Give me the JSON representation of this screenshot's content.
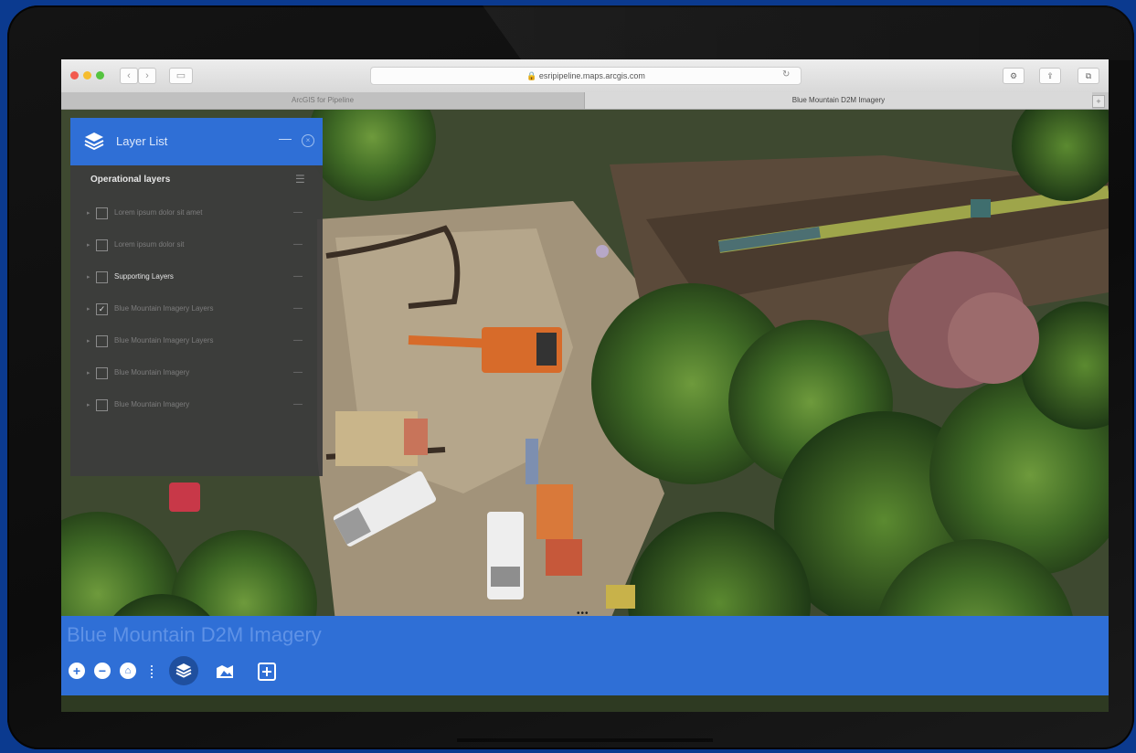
{
  "browser": {
    "url": "esripipeline.maps.arcgis.com",
    "tabs": [
      "ArcGIS for Pipeline",
      "Blue Mountain D2M Imagery"
    ],
    "back_icon": "chevron-left-icon",
    "forward_icon": "chevron-right-icon"
  },
  "layer_list": {
    "title": "Layer List",
    "section_title": "Operational layers",
    "layers": [
      {
        "label": "Lorem ipsum dolor sit amet",
        "checked": false,
        "bright": false
      },
      {
        "label": "Lorem ipsum dolor sit",
        "checked": false,
        "bright": false
      },
      {
        "label": "Supporting Layers",
        "checked": false,
        "bright": true
      },
      {
        "label": "Blue Mountain Imagery Layers",
        "checked": true,
        "bright": false
      },
      {
        "label": "Blue Mountain Imagery Layers",
        "checked": false,
        "bright": false
      },
      {
        "label": "Blue Mountain Imagery",
        "checked": false,
        "bright": false
      },
      {
        "label": "Blue Mountain Imagery",
        "checked": false,
        "bright": false
      }
    ]
  },
  "app": {
    "title": "Blue Mountain D2M Imagery",
    "tools": {
      "zoom_in": "+",
      "zoom_out": "−",
      "home_icon": "home-icon",
      "layers_icon": "layers-icon",
      "basemap_icon": "basemap-icon",
      "legend_icon": "legend-icon"
    }
  },
  "colors": {
    "accent": "#2f6fd6",
    "panel_bg": "#3c3c3c",
    "background": "#0b3a8f"
  }
}
